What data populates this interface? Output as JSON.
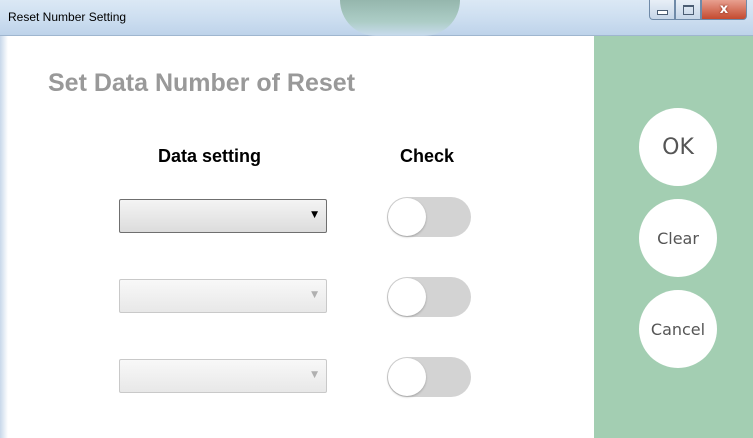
{
  "window": {
    "title": "Reset Number Setting",
    "controls": {
      "minimize": "minimize-icon",
      "maximize": "maximize-icon",
      "close": "close-icon",
      "close_glyph": "x"
    }
  },
  "main": {
    "heading": "Set Data Number of Reset",
    "columns": {
      "data_setting": "Data setting",
      "check": "Check"
    },
    "rows": [
      {
        "dropdown_value": "",
        "dropdown_enabled": true,
        "check_on": false
      },
      {
        "dropdown_value": "",
        "dropdown_enabled": false,
        "check_on": false
      },
      {
        "dropdown_value": "",
        "dropdown_enabled": false,
        "check_on": false
      }
    ]
  },
  "actions": {
    "ok": "OK",
    "clear": "Clear",
    "cancel": "Cancel"
  },
  "colors": {
    "panel": "#a3ceb2",
    "heading": "#999999",
    "toggle_off": "#d3d3d3"
  }
}
